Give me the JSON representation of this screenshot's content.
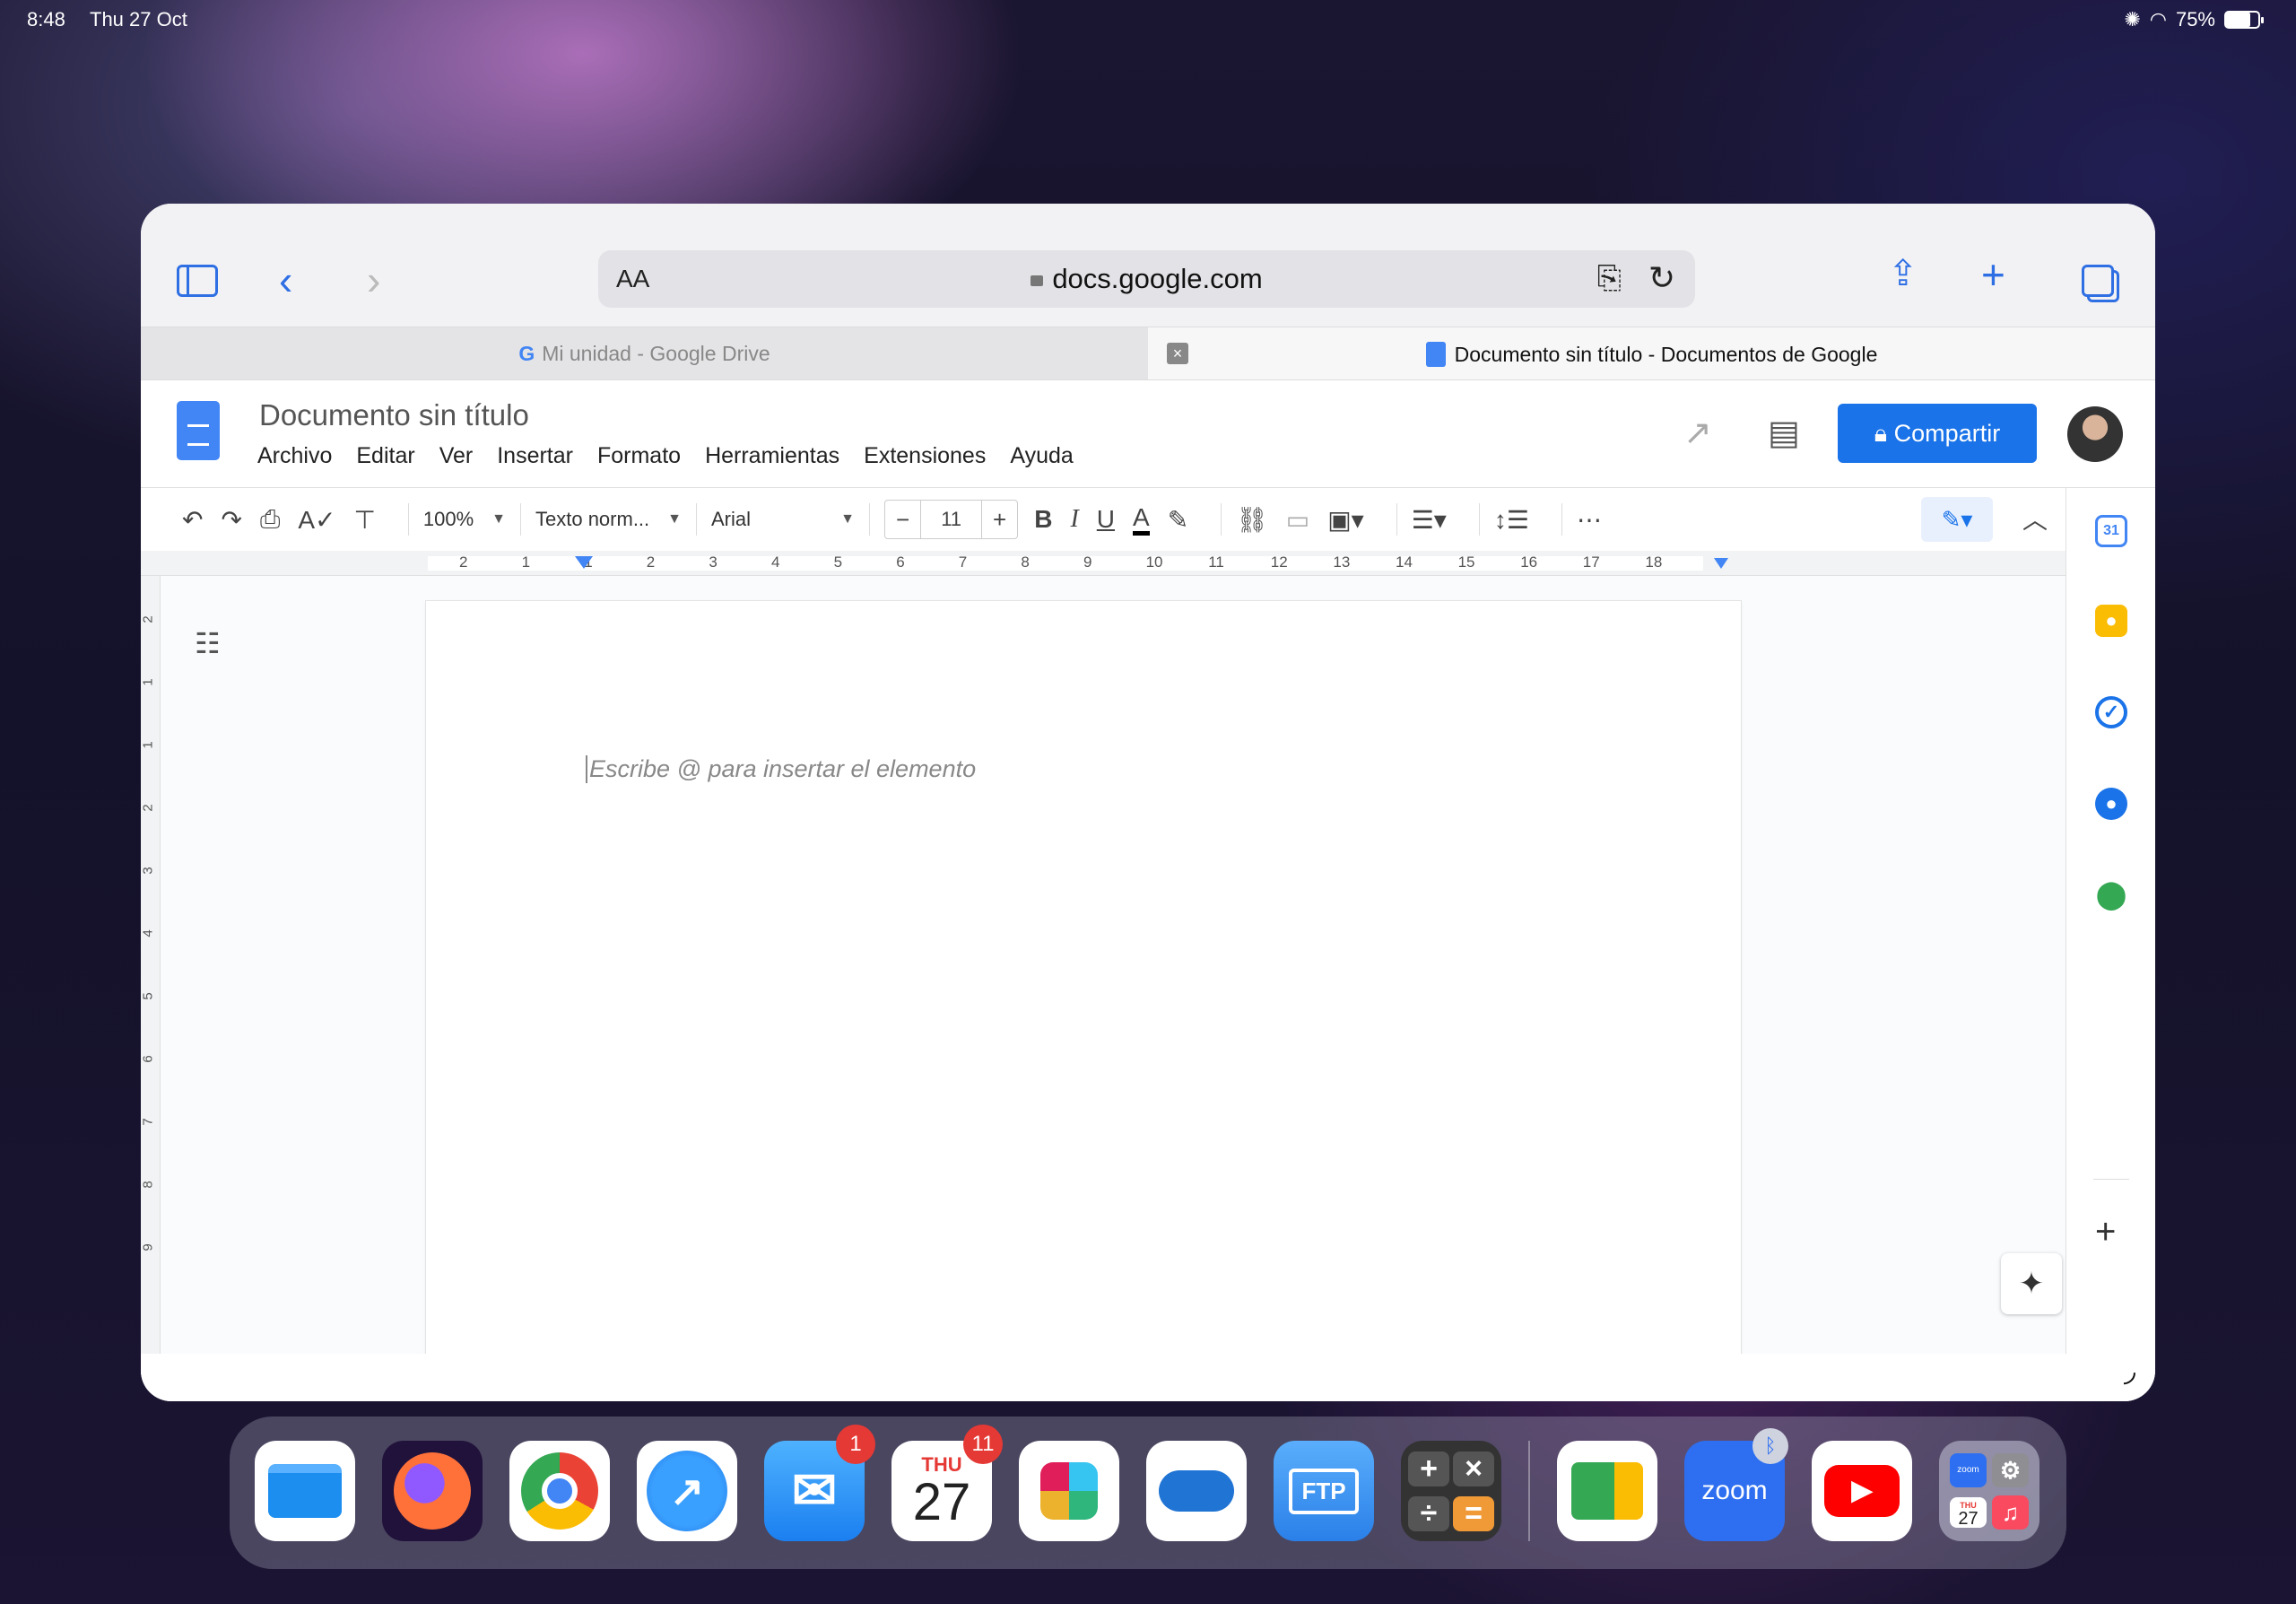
{
  "status_bar": {
    "time": "8:48",
    "date": "Thu 27 Oct",
    "battery": "75%",
    "battery_level": 0.75
  },
  "browser": {
    "aa_label": "AA",
    "url": "docs.google.com",
    "tabs": [
      {
        "label": "Mi unidad - Google Drive",
        "active": false
      },
      {
        "label": "Documento sin título - Documentos de Google",
        "active": true
      }
    ]
  },
  "docs": {
    "title": "Documento sin título",
    "menu": [
      "Archivo",
      "Editar",
      "Ver",
      "Insertar",
      "Formato",
      "Herramientas",
      "Extensiones",
      "Ayuda"
    ],
    "share_label": "Compartir",
    "toolbar": {
      "zoom": "100%",
      "style": "Texto norm...",
      "font": "Arial",
      "font_size": "11",
      "bold": "B",
      "italic": "I",
      "underline": "U",
      "text_color": "A"
    },
    "ruler_numbers": [
      "2",
      "1",
      "1",
      "2",
      "3",
      "4",
      "5",
      "6",
      "7",
      "8",
      "9",
      "10",
      "11",
      "12",
      "13",
      "14",
      "15",
      "16",
      "17",
      "18"
    ],
    "vertical_ruler_numbers": [
      "2",
      "1",
      "1",
      "2",
      "3",
      "4",
      "5",
      "6",
      "7",
      "8",
      "9"
    ],
    "placeholder": "Escribe @ para insertar el elemento",
    "side_panel": {
      "calendar_label": "31"
    },
    "accent_color": "#1a73e8"
  },
  "dock": {
    "apps": [
      {
        "name": "Files"
      },
      {
        "name": "Firefox"
      },
      {
        "name": "Chrome"
      },
      {
        "name": "Safari"
      },
      {
        "name": "Mail",
        "badge": "1"
      },
      {
        "name": "Calendar",
        "day": "THU",
        "date": "27",
        "badge": "11"
      },
      {
        "name": "Slack"
      },
      {
        "name": "OneDrive"
      },
      {
        "name": "FTP",
        "label": "FTP"
      },
      {
        "name": "Calculator"
      },
      {
        "name": "Google Meet"
      },
      {
        "name": "Zoom",
        "label": "zoom"
      },
      {
        "name": "YouTube"
      },
      {
        "name": "App Library"
      }
    ],
    "folder_zoom_label": "zoom",
    "folder_cal_day": "THU",
    "folder_cal_date": "27"
  }
}
